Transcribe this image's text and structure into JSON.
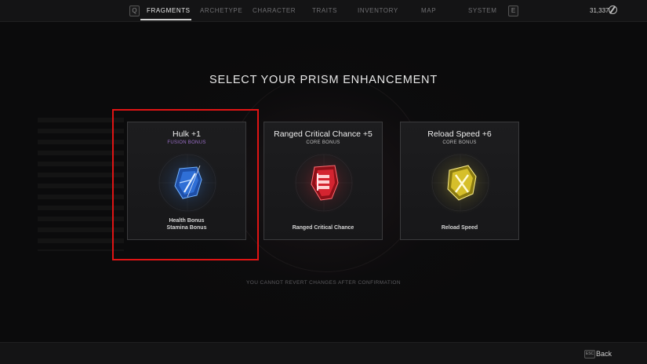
{
  "topbar": {
    "left_key": "Q",
    "right_key": "E",
    "tabs": [
      {
        "label": "FRAGMENTS"
      },
      {
        "label": "ARCHETYPE"
      },
      {
        "label": "CHARACTER"
      },
      {
        "label": "TRAITS"
      },
      {
        "label": "INVENTORY"
      },
      {
        "label": "MAP"
      },
      {
        "label": "SYSTEM"
      }
    ],
    "active_tab": "FRAGMENTS",
    "currency_amount": "31,337",
    "currency_icon": "scrap-icon"
  },
  "heading": "SELECT YOUR PRISM ENHANCEMENT",
  "cards": [
    {
      "title": "Hulk +1",
      "subtitle": "FUSION BONUS",
      "desc_line1": "Health Bonus",
      "desc_line2": "Stamina Bonus",
      "icon": "blue-crystal-icon",
      "color": "#3a8cff",
      "selected": true
    },
    {
      "title": "Ranged Critical Chance +5",
      "subtitle": "CORE BONUS",
      "desc_line1": "Ranged Critical Chance",
      "icon": "red-crystal-icon",
      "color": "#e8323c",
      "selected": false
    },
    {
      "title": "Reload Speed +6",
      "subtitle": "CORE BONUS",
      "desc_line1": "Reload Speed",
      "icon": "yellow-crystal-icon",
      "color": "#e3cf3a",
      "selected": false
    }
  ],
  "warning": "YOU CANNOT REVERT CHANGES AFTER CONFIRMATION",
  "footer": {
    "esc_key": "ESC",
    "back_label": "Back"
  },
  "colors": {
    "highlight": "#e01414",
    "fusion": "#9b6fc8"
  }
}
